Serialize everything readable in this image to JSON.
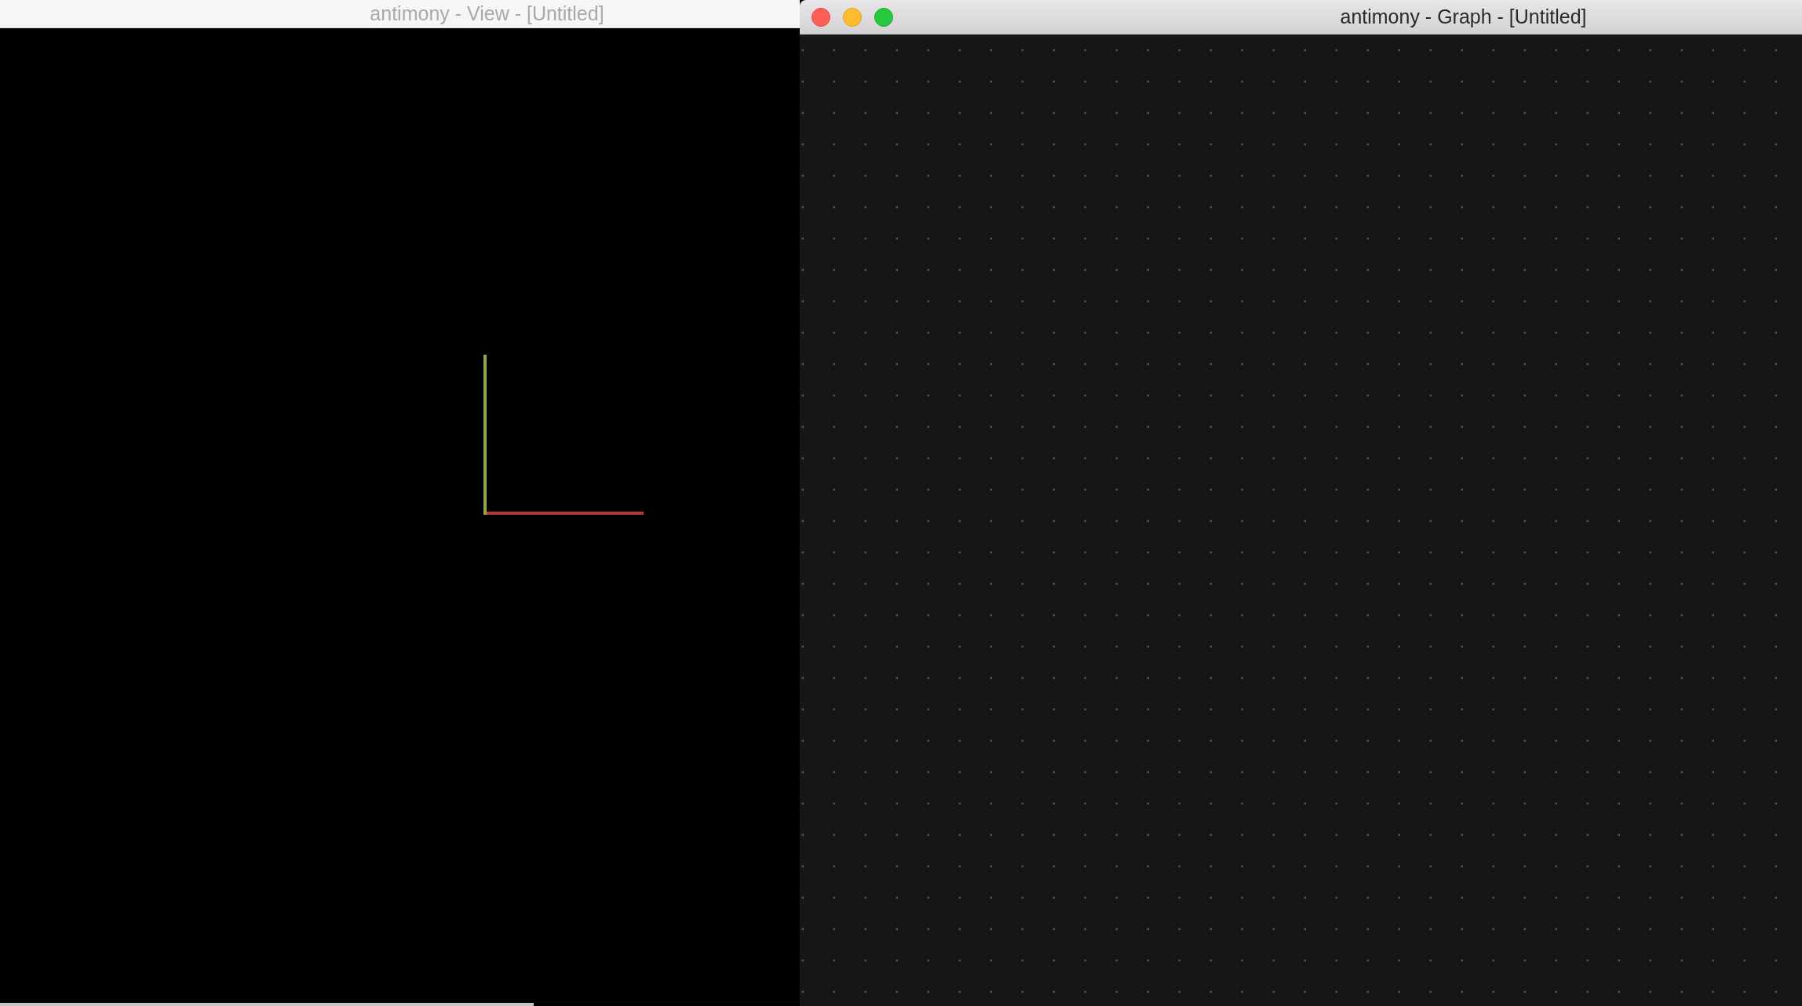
{
  "windows": [
    {
      "title": "antimony - View - [Untitled]",
      "focused": false,
      "kind": "view"
    },
    {
      "title": "antimony - Graph - [Untitled]",
      "focused": true,
      "kind": "graph"
    }
  ]
}
